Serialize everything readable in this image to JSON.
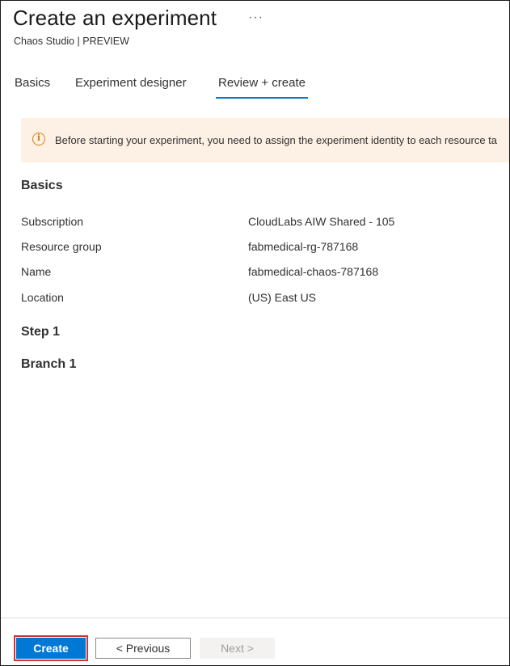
{
  "header": {
    "title": "Create an experiment",
    "more_label": "···",
    "subtitle": "Chaos Studio | PREVIEW"
  },
  "tabs": [
    {
      "label": "Basics",
      "active": false
    },
    {
      "label": "Experiment designer",
      "active": false
    },
    {
      "label": "Review + create",
      "active": true
    }
  ],
  "banner": {
    "icon": "info-icon",
    "text": "Before starting your experiment, you need to assign the experiment identity to each resource ta"
  },
  "sections": {
    "basics_heading": "Basics",
    "rows": [
      {
        "label": "Subscription",
        "value": "CloudLabs AIW Shared - 105"
      },
      {
        "label": "Resource group",
        "value": "fabmedical-rg-787168"
      },
      {
        "label": "Name",
        "value": "fabmedical-chaos-787168"
      },
      {
        "label": "Location",
        "value": "(US) East US"
      }
    ],
    "step_heading": "Step 1",
    "branch_heading": "Branch 1"
  },
  "footer": {
    "create_label": "Create",
    "previous_label": "< Previous",
    "next_label": "Next >"
  },
  "colors": {
    "accent": "#0078d4",
    "banner_bg": "#fdf1e6",
    "warning": "#d67f15",
    "highlight_border": "#d13438"
  }
}
